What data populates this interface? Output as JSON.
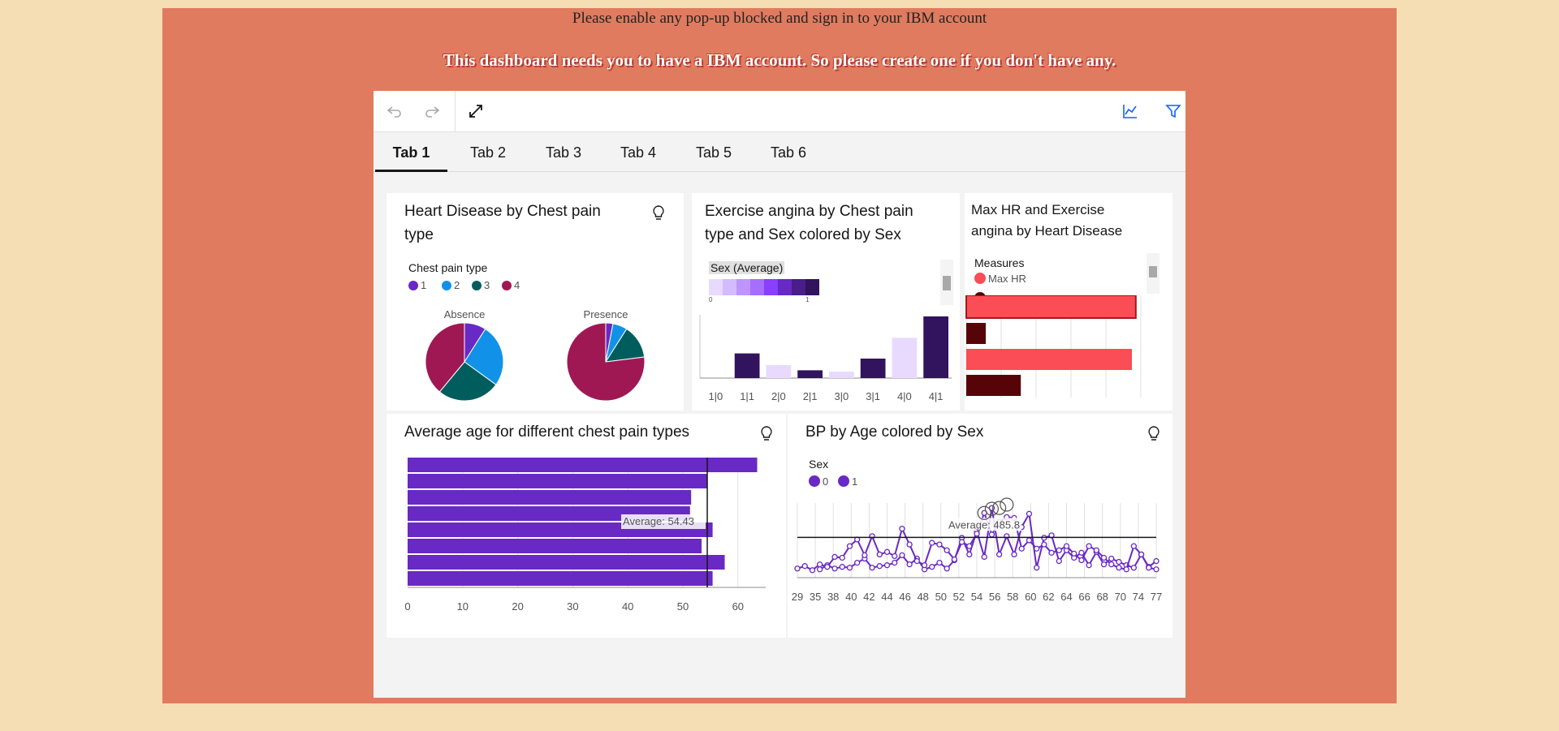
{
  "notices": {
    "line1": "Please enable any pop-up blocked and sign in to your IBM account",
    "line2": "This dashboard needs you to have a IBM account. So please create one if you don't have any."
  },
  "toolbar": {
    "undo_icon": "undo-icon",
    "redo_icon": "redo-icon",
    "fullscreen_icon": "expand-icon",
    "chart_icon": "line-chart-icon",
    "filter_icon": "filter-icon"
  },
  "tabs": [
    {
      "label": "Tab 1",
      "active": true
    },
    {
      "label": "Tab 2"
    },
    {
      "label": "Tab 3"
    },
    {
      "label": "Tab 4"
    },
    {
      "label": "Tab 5"
    },
    {
      "label": "Tab 6"
    }
  ],
  "colors": {
    "type1": "#6929c4",
    "type2": "#1192e8",
    "type3": "#005d5d",
    "type4": "#9f1853",
    "maxhr": "#fa4d56",
    "angina": "#570408"
  },
  "cards": {
    "pie": {
      "title": "Heart Disease by Chest pain type",
      "legend_title": "Chest pain type",
      "legend": [
        "1",
        "2",
        "3",
        "4"
      ]
    },
    "angina": {
      "title": "Exercise angina by Chest pain type and Sex colored by Sex",
      "legend_title": "Sex (Average)",
      "scale_min": "0",
      "scale_max": "1"
    },
    "maxhr": {
      "title": "Max HR and Exercise angina by Heart Disease",
      "legend_title": "Measures",
      "legend_item": "Max HR"
    },
    "avgage": {
      "title": "Average age for different chest pain types",
      "avg_label": "Average: 54.43"
    },
    "bp": {
      "title": "BP by Age colored by Sex",
      "legend_title": "Sex",
      "legend": [
        "0",
        "1"
      ],
      "avg_label": "Average: 485.8"
    }
  },
  "chart_data": [
    {
      "type": "pie",
      "title": "Heart Disease by Chest pain type",
      "categories": [
        "1",
        "2",
        "3",
        "4"
      ],
      "series": [
        {
          "name": "Absence",
          "values": [
            9,
            26,
            26,
            39
          ]
        },
        {
          "name": "Presence",
          "values": [
            3,
            6,
            14,
            77
          ]
        }
      ]
    },
    {
      "type": "bar",
      "title": "Exercise angina by Chest pain type and Sex colored by Sex",
      "categories": [
        "1|0",
        "1|1",
        "2|0",
        "2|1",
        "3|0",
        "3|1",
        "4|0",
        "4|1"
      ],
      "values": [
        0,
        0.38,
        0.2,
        0.12,
        0.1,
        0.3,
        0.62,
        0.95
      ],
      "ylim": [
        0,
        1
      ]
    },
    {
      "type": "bar",
      "title": "Max HR and Exercise angina by Heart Disease",
      "orientation": "horizontal",
      "series": [
        {
          "name": "Max HR",
          "values": [
            0.87,
            0.85
          ]
        },
        {
          "name": "Exercise angina",
          "values": [
            0.1,
            0.28
          ]
        }
      ]
    },
    {
      "type": "bar",
      "title": "Average age for different chest pain types",
      "orientation": "horizontal",
      "values": [
        63.5,
        54.5,
        51.5,
        51.3,
        55.4,
        53.4,
        57.6,
        55.4
      ],
      "xticks": [
        "0",
        "10",
        "20",
        "30",
        "40",
        "50",
        "60"
      ],
      "xlim": [
        0,
        65
      ],
      "average": 54.43
    },
    {
      "type": "line",
      "title": "BP by Age colored by Sex",
      "x": [
        29,
        30,
        31,
        32,
        33,
        34,
        35,
        36,
        37,
        38,
        39,
        40,
        41,
        42,
        43,
        44,
        45,
        46,
        47,
        48,
        49,
        50,
        51,
        52,
        53,
        54,
        55,
        56,
        57,
        58,
        59,
        60,
        61,
        62,
        63,
        64,
        65,
        66,
        67,
        68,
        69,
        70,
        71,
        72,
        73,
        74,
        75,
        76,
        77
      ],
      "xticks": [
        "29",
        "35",
        "38",
        "40",
        "42",
        "44",
        "46",
        "48",
        "50",
        "52",
        "54",
        "56",
        "58",
        "60",
        "62",
        "64",
        "66",
        "68",
        "70",
        "74",
        "77"
      ],
      "series": [
        {
          "name": "0",
          "values": [
            null,
            null,
            null,
            100,
            150,
            110,
            130,
            120,
            180,
            230,
            120,
            140,
            150,
            180,
            270,
            160,
            230,
            100,
            130,
            180,
            110,
            210,
            480,
            280,
            560,
            250,
            840,
            280,
            500,
            280,
            610,
            770,
            120,
            480,
            510,
            200,
            330,
            240,
            300,
            150,
            310,
            160,
            230,
            190,
            150,
            120,
            280,
            130,
            200
          ]
        },
        {
          "name": "1",
          "values": [
            110,
            140,
            90,
            160,
            130,
            250,
            240,
            380,
            460,
            270,
            500,
            280,
            310,
            260,
            590,
            400,
            200,
            150,
            420,
            400,
            330,
            220,
            430,
            380,
            530,
            780,
            520,
            670,
            730,
            720,
            350,
            450,
            350,
            400,
            300,
            330,
            380,
            290,
            210,
            380,
            330,
            240,
            160,
            120,
            100,
            380,
            280,
            120,
            100
          ]
        }
      ],
      "average": 485.8
    }
  ]
}
